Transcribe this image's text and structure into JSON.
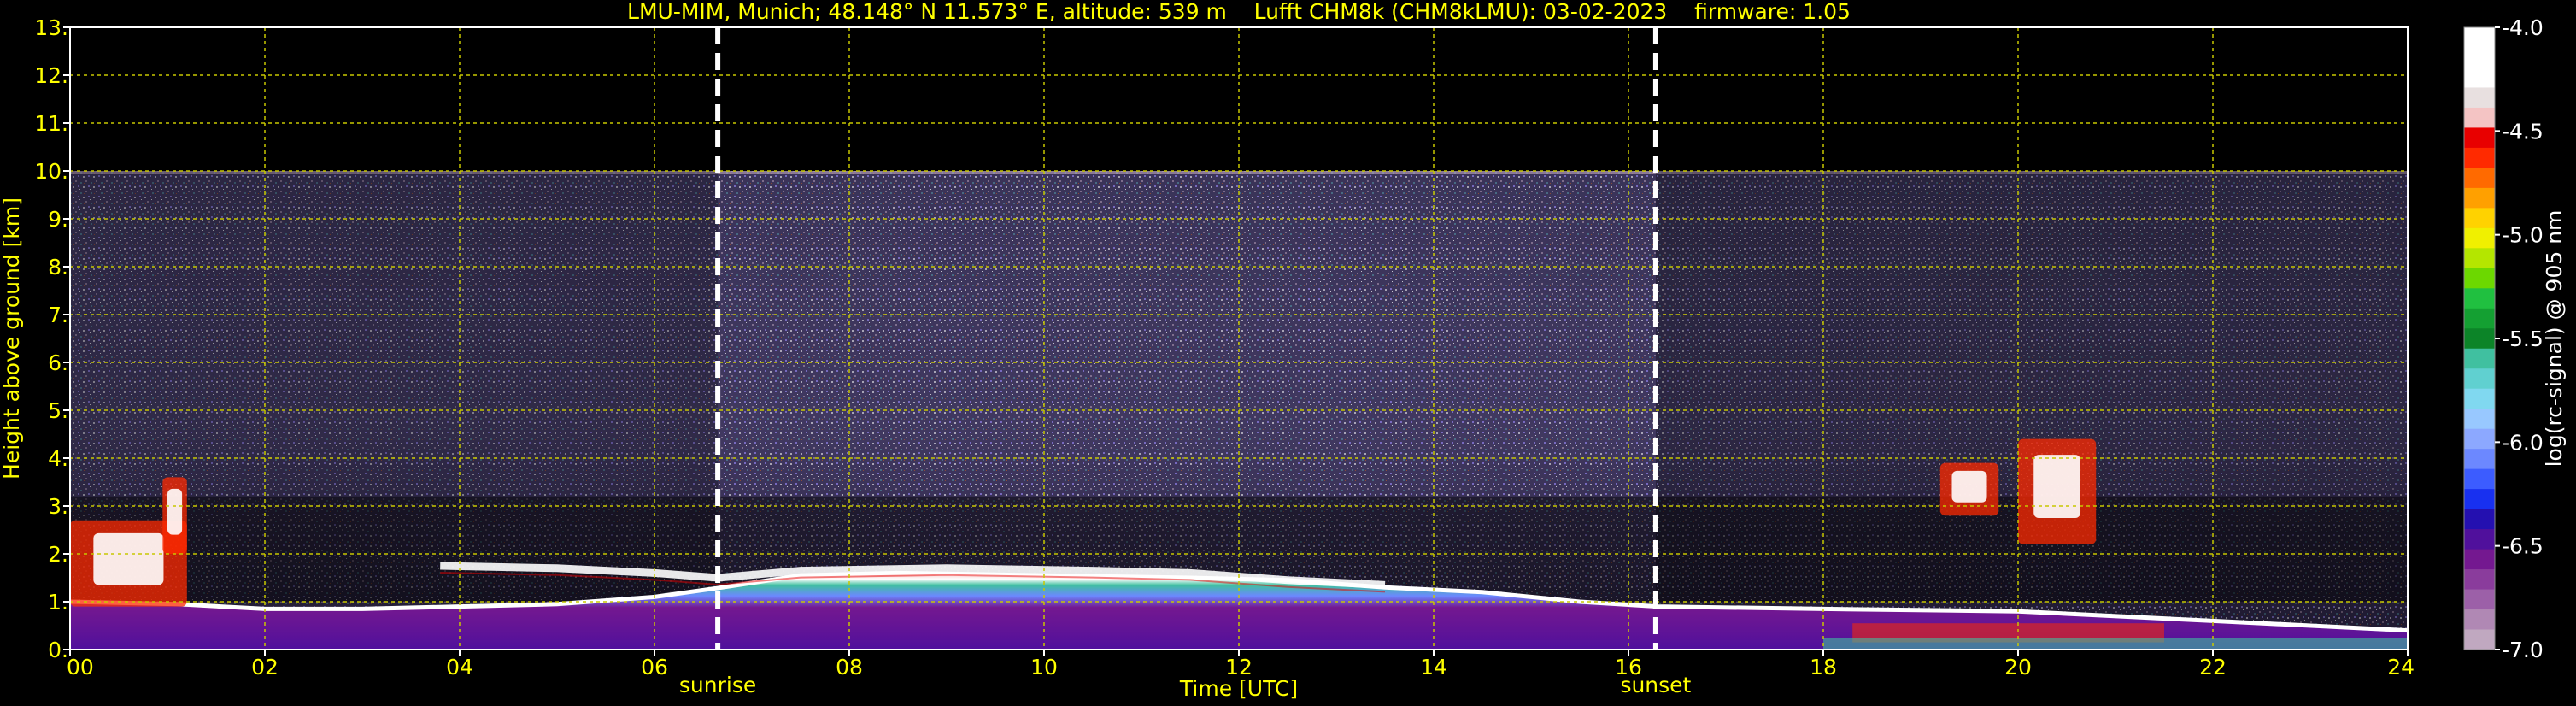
{
  "chart_data": {
    "type": "heatmap",
    "title": "LMU-MIM, Munich; 48.148° N 11.573° E, altitude: 539 m    Lufft CHM8k (CHM8kLMU): 03-02-2023    firmware: 1.05",
    "xlabel": "Time [UTC]",
    "ylabel": "Height above ground [km]",
    "xlim": [
      0,
      24
    ],
    "ylim": [
      0,
      13
    ],
    "x_ticks": [
      "00",
      "02",
      "04",
      "06",
      "08",
      "10",
      "12",
      "14",
      "16",
      "18",
      "20",
      "22",
      "24"
    ],
    "x_tick_values": [
      0,
      2,
      4,
      6,
      8,
      10,
      12,
      14,
      16,
      18,
      20,
      22,
      24
    ],
    "y_ticks": [
      "0.",
      "1.",
      "2.",
      "3.",
      "4.",
      "5.",
      "6.",
      "7.",
      "8.",
      "9.",
      "10.",
      "11.",
      "12.",
      "13."
    ],
    "y_tick_values": [
      0,
      1,
      2,
      3,
      4,
      5,
      6,
      7,
      8,
      9,
      10,
      11,
      12,
      13
    ],
    "grid": true,
    "signal_top_km": 10.0,
    "events": [
      {
        "label": "sunrise",
        "x": 6.65
      },
      {
        "label": "sunset",
        "x": 16.28
      }
    ],
    "boundary_layer_top_km": [
      [
        0.0,
        1.0
      ],
      [
        1.1,
        0.95
      ],
      [
        2.0,
        0.85
      ],
      [
        3.0,
        0.85
      ],
      [
        4.0,
        0.9
      ],
      [
        5.0,
        0.95
      ],
      [
        6.0,
        1.1
      ],
      [
        6.7,
        1.3
      ],
      [
        7.5,
        1.55
      ],
      [
        8.5,
        1.6
      ],
      [
        10.0,
        1.55
      ],
      [
        11.5,
        1.5
      ],
      [
        12.5,
        1.45
      ],
      [
        13.5,
        1.3
      ],
      [
        14.5,
        1.2
      ],
      [
        15.5,
        1.0
      ],
      [
        16.3,
        0.9
      ],
      [
        18.0,
        0.85
      ],
      [
        20.0,
        0.8
      ],
      [
        22.0,
        0.6
      ],
      [
        24.0,
        0.4
      ]
    ],
    "cloud_layer_km": [
      [
        3.8,
        1.75
      ],
      [
        5.0,
        1.7
      ],
      [
        6.0,
        1.6
      ],
      [
        6.65,
        1.5
      ],
      [
        7.5,
        1.65
      ],
      [
        9.0,
        1.7
      ],
      [
        10.5,
        1.65
      ],
      [
        11.5,
        1.6
      ],
      [
        12.5,
        1.45
      ],
      [
        13.5,
        1.35
      ]
    ],
    "cloud_patches": [
      {
        "x0": 0.0,
        "x1": 1.2,
        "y0": 0.9,
        "y1": 2.7
      },
      {
        "x0": 0.95,
        "x1": 1.2,
        "y0": 2.0,
        "y1": 3.6
      },
      {
        "x0": 19.2,
        "x1": 19.8,
        "y0": 2.8,
        "y1": 3.9
      },
      {
        "x0": 20.0,
        "x1": 20.8,
        "y0": 2.2,
        "y1": 4.4
      }
    ],
    "colorbar": {
      "label": "log(rc-signal) @ 905 nm",
      "range": [
        -7.0,
        -4.0
      ],
      "tick_values": [
        -4.0,
        -4.5,
        -5.0,
        -5.5,
        -6.0,
        -6.5,
        -7.0
      ],
      "tick_labels": [
        "-4.0",
        "-4.5",
        "-5.0",
        "-5.5",
        "-6.0",
        "-6.5",
        "-7.0"
      ],
      "colors_top_to_bottom": [
        "#ffffff",
        "#ffffff",
        "#ffffff",
        "#e8e0e0",
        "#f4c4c4",
        "#e80000",
        "#ff2a00",
        "#ff6a00",
        "#ffa000",
        "#ffd200",
        "#f0f000",
        "#b4e600",
        "#6cd800",
        "#20c040",
        "#14a032",
        "#0c8428",
        "#40c0a0",
        "#60d0d0",
        "#80d8f0",
        "#98c8ff",
        "#8ca8ff",
        "#6c88ff",
        "#3c5cff",
        "#1830f0",
        "#2410b0",
        "#50109c",
        "#741890",
        "#8a3c9c",
        "#9c60a8",
        "#b088b4",
        "#c0a8c0"
      ]
    },
    "colors": {
      "background": "#000000",
      "axis_text": "#ffff00",
      "grid": "#c8c800",
      "event_line": "#ffffff",
      "colorbar_text": "#ffffff"
    }
  }
}
